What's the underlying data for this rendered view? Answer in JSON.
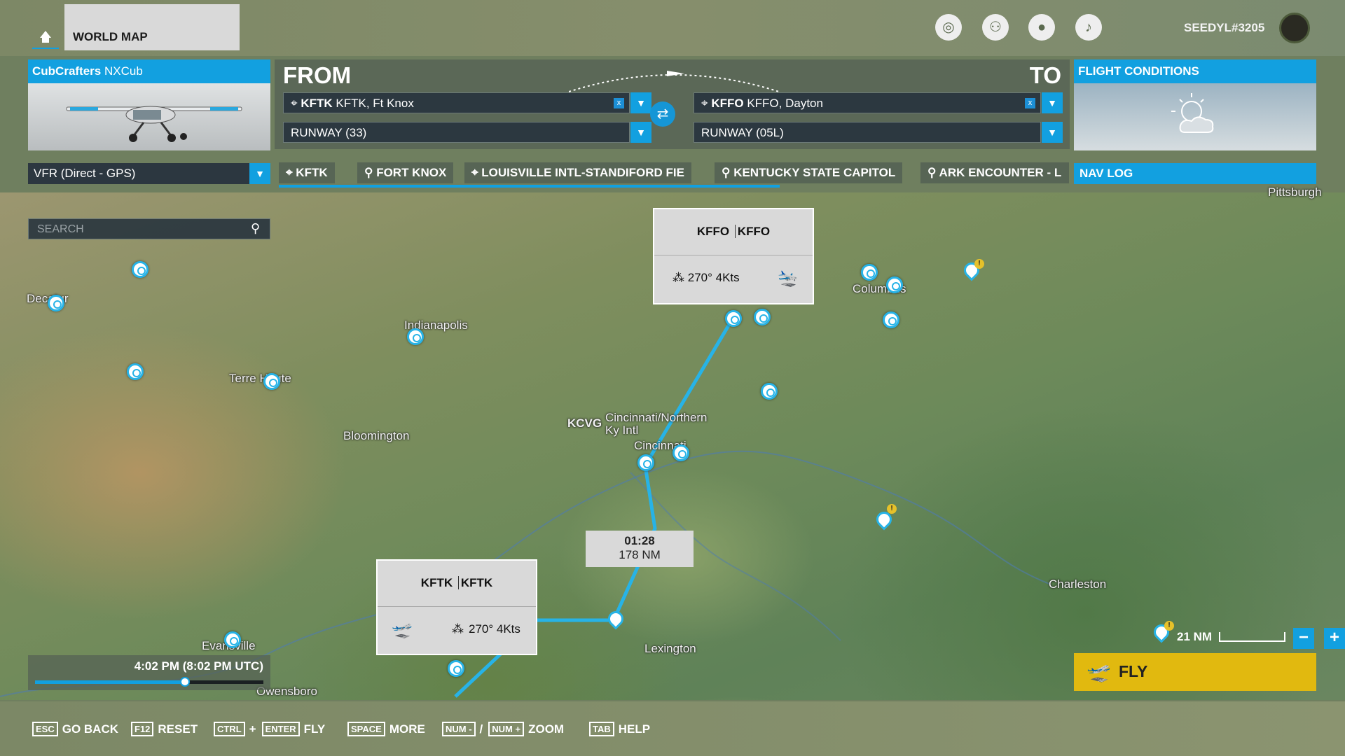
{
  "topbar": {
    "home_icon": "home-icon",
    "world_map_label": "WORLD MAP",
    "icons": [
      "activity-icon",
      "friends-icon",
      "profile-icon",
      "notifications-icon"
    ],
    "username": "SEEDYL#3205"
  },
  "aircraft": {
    "brand": "CubCrafters",
    "model": "NXCub"
  },
  "route": {
    "from_label": "FROM",
    "to_label": "TO",
    "departure": {
      "code": "KFTK",
      "name": "KFTK, Ft Knox",
      "runway": "RUNWAY (33)"
    },
    "arrival": {
      "code": "KFFO",
      "name": "KFFO, Dayton",
      "runway": "RUNWAY (05L)"
    },
    "clear_label": "x"
  },
  "conditions": {
    "title": "FLIGHT CONDITIONS",
    "icon": "partly-cloudy-icon"
  },
  "flight_type": "VFR (Direct - GPS)",
  "waypoints": [
    "KFTK",
    "FORT KNOX",
    "LOUISVILLE INTL-STANDIFORD FIE",
    "KENTUCKY STATE CAPITOL",
    "ARK ENCOUNTER - L"
  ],
  "nav_log_label": "NAV LOG",
  "search_placeholder": "SEARCH",
  "map": {
    "cities": [
      "Pittsburgh",
      "Decatur",
      "Indianapolis",
      "Columbus",
      "Terre Haute",
      "Bloomington",
      "KCVG",
      "Cincinnati/Northern",
      "Ky Intl",
      "Cincinnati",
      "Lexington",
      "Charleston",
      "Evansville",
      "Owensboro"
    ],
    "destination_callout": {
      "code": "KFFO",
      "name": "KFFO",
      "wind": "270° 4Kts"
    },
    "departure_callout": {
      "code": "KFTK",
      "name": "KFTK",
      "wind": "270° 4Kts"
    },
    "route_summary": {
      "time": "01:28",
      "distance": "178 NM"
    },
    "route_color": "#27b3e7"
  },
  "time": {
    "label": "4:02 PM (8:02 PM UTC)",
    "slider_fraction": 0.66
  },
  "scale": {
    "label": "21 NM"
  },
  "zoom": {
    "minus": "−",
    "plus": "+"
  },
  "fly_label": "FLY",
  "footer": {
    "hints": [
      {
        "keys": [
          "ESC"
        ],
        "label": "GO BACK"
      },
      {
        "keys": [
          "F12"
        ],
        "label": "RESET"
      },
      {
        "keys": [
          "CTRL",
          "ENTER"
        ],
        "separator": "+",
        "label": "FLY"
      },
      {
        "keys": [
          "SPACE"
        ],
        "label": "MORE"
      },
      {
        "keys": [
          "NUM -",
          "NUM +"
        ],
        "separator": "/",
        "label": "ZOOM"
      },
      {
        "keys": [
          "TAB"
        ],
        "label": "HELP"
      }
    ]
  },
  "colors": {
    "accent": "#12a0e0",
    "fly": "#e1b90f"
  }
}
